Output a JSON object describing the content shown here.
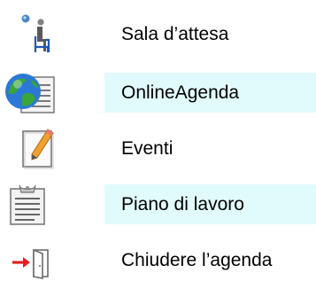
{
  "menu": {
    "highlight_color": "#e1fbfc",
    "items": [
      {
        "label": "Sala d’attesa",
        "icon": "waiting-room-icon",
        "highlighted": false
      },
      {
        "label": "OnlineAgenda",
        "icon": "globe-document-icon",
        "highlighted": true
      },
      {
        "label": "Eventi",
        "icon": "notepad-pencil-icon",
        "highlighted": false
      },
      {
        "label": "Piano di lavoro",
        "icon": "clipboard-icon",
        "highlighted": true
      },
      {
        "label": "Chiudere l’agenda",
        "icon": "exit-door-icon",
        "highlighted": false
      }
    ]
  }
}
